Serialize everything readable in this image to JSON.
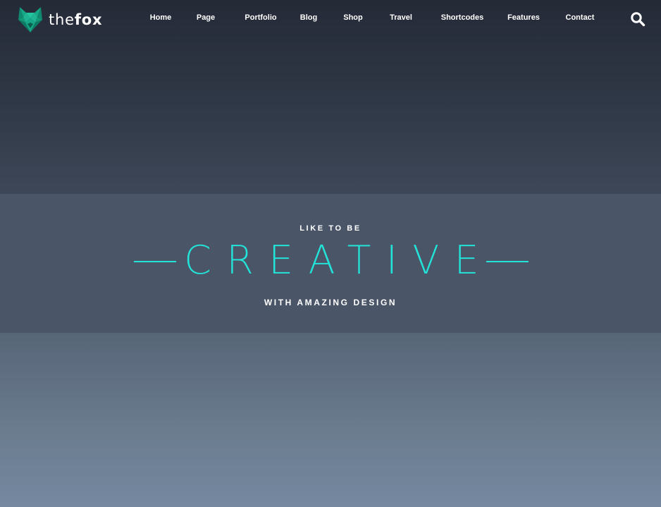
{
  "brand": {
    "name_light": "the",
    "name_bold": "fox",
    "logo_icon": "fox-head-icon",
    "accent_color": "#1fb592"
  },
  "nav": {
    "items": [
      {
        "label": "Home"
      },
      {
        "label": "Page"
      },
      {
        "label": "Portfolio"
      },
      {
        "label": "Blog"
      },
      {
        "label": "Shop"
      },
      {
        "label": "Travel"
      },
      {
        "label": "Shortcodes"
      },
      {
        "label": "Features"
      },
      {
        "label": "Contact"
      }
    ],
    "search_icon": "search-icon"
  },
  "hero": {
    "kicker": "LIKE TO BE",
    "headline": "CREATIVE",
    "subline": "WITH AMAZING DESIGN",
    "headline_color": "#22e4d8",
    "band_color": "#4a5568"
  }
}
